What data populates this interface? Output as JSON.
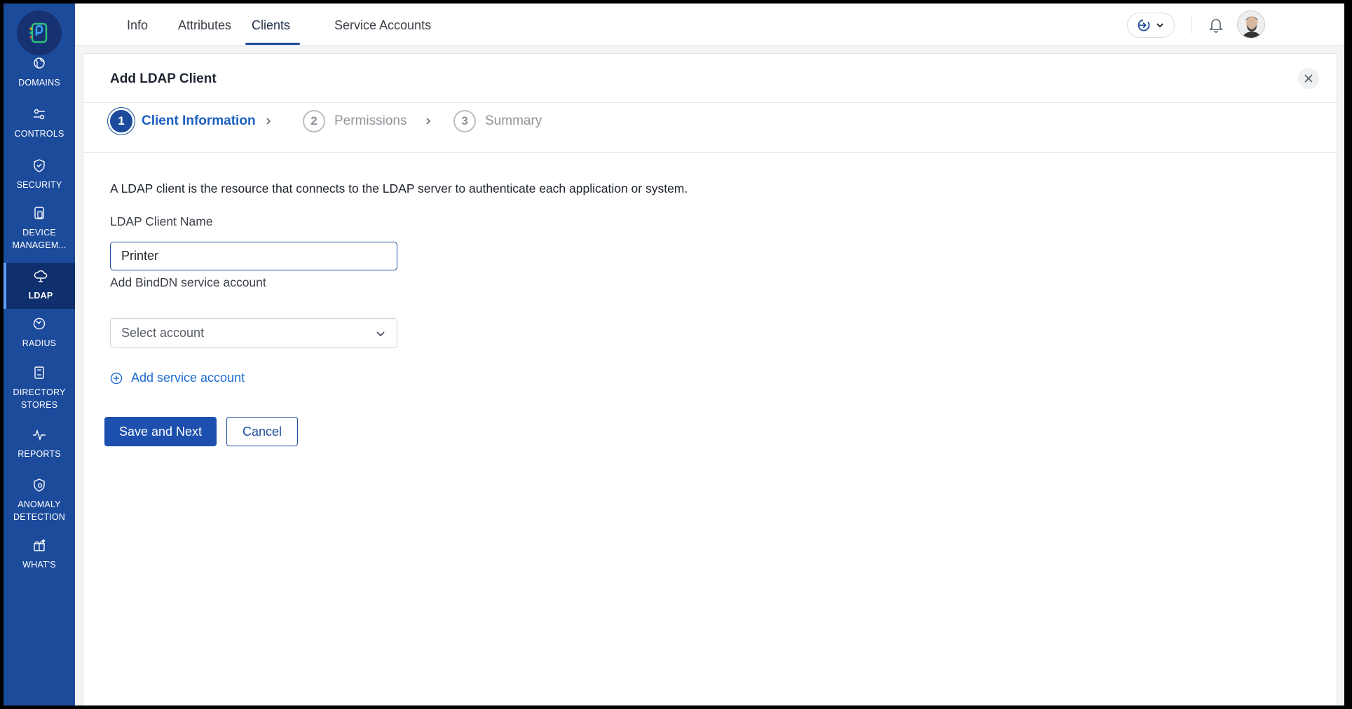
{
  "sidebar": {
    "items": [
      {
        "label_lines": [
          "DOMAINS"
        ],
        "icon": "domains-icon",
        "active": false
      },
      {
        "label_lines": [
          "CONTROLS"
        ],
        "icon": "controls-icon",
        "active": false
      },
      {
        "label_lines": [
          "SECURITY"
        ],
        "icon": "security-shield-icon",
        "active": false
      },
      {
        "label_lines": [
          "DEVICE",
          "MANAGEM..."
        ],
        "icon": "device-icon",
        "active": false
      },
      {
        "label_lines": [
          "LDAP"
        ],
        "icon": "ldap-cloud-icon",
        "active": true
      },
      {
        "label_lines": [
          "RADIUS"
        ],
        "icon": "radius-icon",
        "active": false
      },
      {
        "label_lines": [
          "DIRECTORY",
          "STORES"
        ],
        "icon": "directory-stores-icon",
        "active": false
      },
      {
        "label_lines": [
          "REPORTS"
        ],
        "icon": "reports-icon",
        "active": false
      },
      {
        "label_lines": [
          "ANOMALY",
          "DETECTION"
        ],
        "icon": "anomaly-detection-icon",
        "active": false
      },
      {
        "label_lines": [
          "WHAT'S"
        ],
        "icon": "whats-new-gift-icon",
        "active": false
      }
    ]
  },
  "topbar": {
    "tabs": [
      "Info",
      "Attributes",
      "Clients",
      "Service Accounts"
    ],
    "active_tab": "Clients"
  },
  "panel": {
    "title": "Add LDAP Client",
    "steps": [
      {
        "number": "1",
        "label": "Client Information",
        "active": true
      },
      {
        "number": "2",
        "label": "Permissions",
        "active": false
      },
      {
        "number": "3",
        "label": "Summary",
        "active": false
      }
    ],
    "description": "A LDAP client is the resource that connects to the LDAP server to authenticate each application or system.",
    "client_name_label": "LDAP Client Name",
    "client_name_value": "Printer",
    "binddn_label": "Add BindDN service account",
    "binddn_placeholder": "Select account",
    "add_service_account": "Add service account",
    "save_button": "Save and Next",
    "cancel_button": "Cancel"
  },
  "colors": {
    "sidebar_bg": "#1c4b9c",
    "sidebar_active_bg": "#0f2f6e",
    "accent": "#1c4b9c",
    "link": "#1c6bd0"
  }
}
